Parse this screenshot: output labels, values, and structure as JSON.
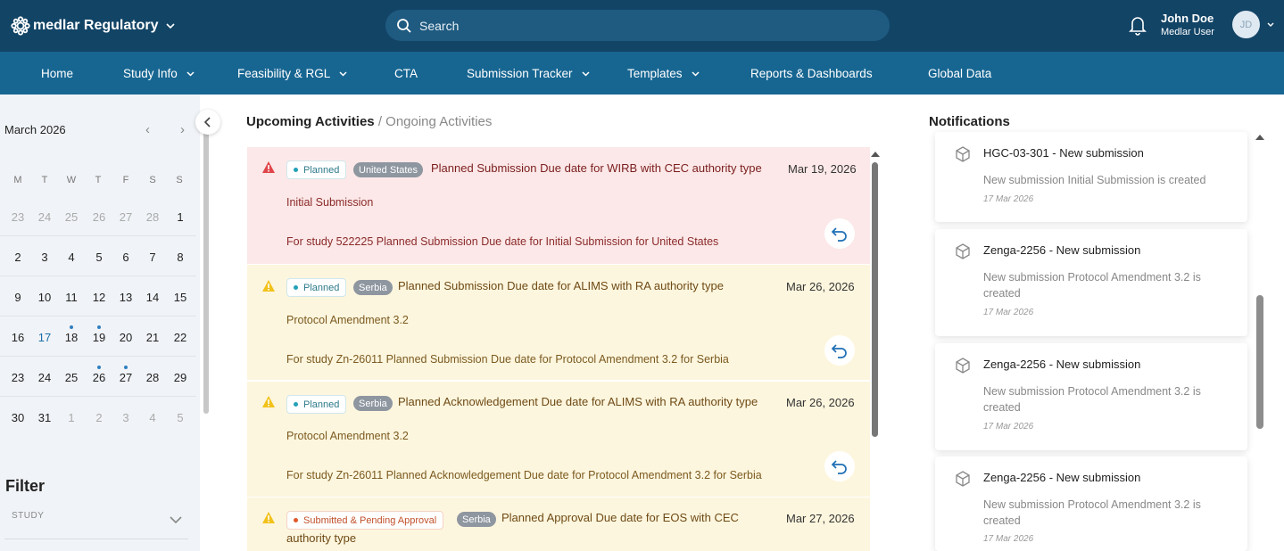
{
  "header": {
    "brand": "medlar Regulatory",
    "search_placeholder": "Search",
    "user_name": "John Doe",
    "user_role": "Medlar User",
    "avatar_initials": "JD"
  },
  "nav": {
    "items": [
      {
        "label": "Home"
      },
      {
        "label": "Study Info"
      },
      {
        "label": "Feasibility & RGL"
      },
      {
        "label": "CTA"
      },
      {
        "label": "Submission Tracker"
      },
      {
        "label": "Templates"
      },
      {
        "label": "Reports & Dashboards"
      },
      {
        "label": "Global Data"
      }
    ]
  },
  "calendar": {
    "month": "March 2026",
    "weekdays": [
      "M",
      "T",
      "W",
      "T",
      "F",
      "S",
      "S"
    ],
    "weeks": [
      [
        "23",
        "24",
        "25",
        "26",
        "27",
        "28",
        "1"
      ],
      [
        "2",
        "3",
        "4",
        "5",
        "6",
        "7",
        "8"
      ],
      [
        "9",
        "10",
        "11",
        "12",
        "13",
        "14",
        "15"
      ],
      [
        "16",
        "17",
        "18",
        "19",
        "20",
        "21",
        "22"
      ],
      [
        "23",
        "24",
        "25",
        "26",
        "27",
        "28",
        "29"
      ],
      [
        "30",
        "31",
        "1",
        "2",
        "3",
        "4",
        "5"
      ]
    ],
    "today": "17",
    "event_days": [
      "18",
      "19",
      "26",
      "27"
    ]
  },
  "filter": {
    "title": "Filter",
    "study_label": "STUDY"
  },
  "activities": {
    "title_active": "Upcoming Activities",
    "separator": "/",
    "title_inactive": "Ongoing Activities",
    "items": [
      {
        "status": "Planned",
        "country": "United States",
        "title": "Planned Submission Due date for WIRB with CEC authority type",
        "date": "Mar 19, 2026",
        "submission": "Initial Submission",
        "detail": "For study 522225 Planned Submission Due date for Initial Submission for United States"
      },
      {
        "status": "Planned",
        "country": "Serbia",
        "title": "Planned Submission Due date for ALIMS with RA authority type",
        "date": "Mar 26, 2026",
        "submission": "Protocol Amendment 3.2",
        "detail": "For study Zn-26011 Planned Submission Due date for Protocol Amendment 3.2 for Serbia"
      },
      {
        "status": "Planned",
        "country": "Serbia",
        "title": "Planned Acknowledgement Due date for ALIMS with RA authority type",
        "date": "Mar 26, 2026",
        "submission": "Protocol Amendment 3.2",
        "detail": "For study Zn-26011 Planned Acknowledgement Due date for Protocol Amendment 3.2 for Serbia"
      },
      {
        "status": "Submitted & Pending Approval",
        "country": "Serbia",
        "title": "Planned Approval Due date for EOS with CEC",
        "title_cont": "authority type",
        "date": "Mar 27, 2026"
      }
    ]
  },
  "notifications": {
    "title": "Notifications",
    "items": [
      {
        "title": "HGC-03-301 - New submission",
        "desc": "New submission Initial Submission is created",
        "date": "17 Mar 2026"
      },
      {
        "title": "Zenga-2256 - New submission",
        "desc": "New submission Protocol Amendment 3.2 is created",
        "date": "17 Mar 2026"
      },
      {
        "title": "Zenga-2256 - New submission",
        "desc": "New submission Protocol Amendment 3.2 is created",
        "date": "17 Mar 2026"
      },
      {
        "title": "Zenga-2256 - New submission",
        "desc": "New submission Protocol Amendment 3.2 is created",
        "date": "17 Mar 2026"
      }
    ]
  },
  "colors": {
    "header_bg": "#124466",
    "nav_bg": "#176692",
    "card_red_bg": "#fce8e8",
    "card_yellow_bg": "#fdf6de",
    "alert_red": "#e0454a",
    "alert_yellow": "#f2c21b"
  }
}
